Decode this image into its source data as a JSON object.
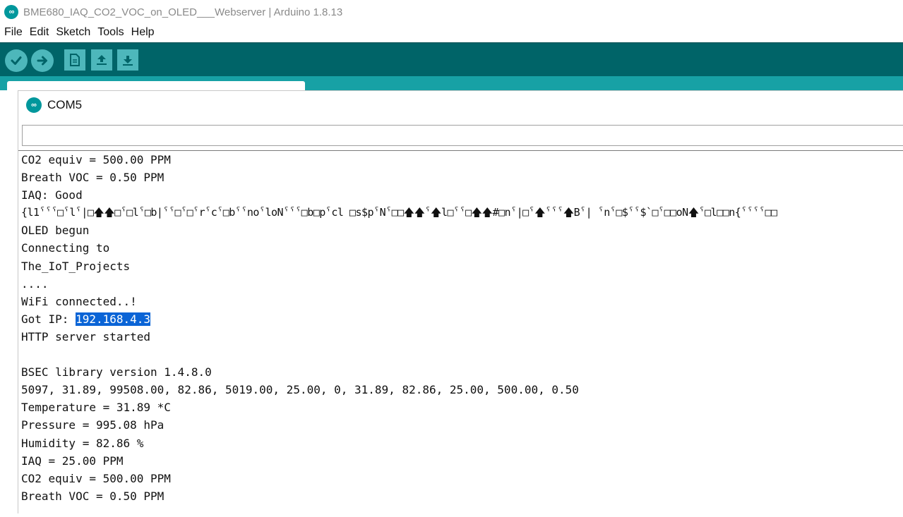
{
  "window": {
    "title": "BME680_IAQ_CO2_VOC_on_OLED___Webserver | Arduino 1.8.13",
    "icon": "arduino-logo-icon"
  },
  "menu": {
    "items": [
      "File",
      "Edit",
      "Sketch",
      "Tools",
      "Help"
    ]
  },
  "toolbar": {
    "buttons": [
      {
        "icon": "verify-icon"
      },
      {
        "icon": "upload-icon"
      },
      {
        "icon": "new-icon"
      },
      {
        "icon": "open-icon"
      },
      {
        "icon": "save-icon"
      }
    ]
  },
  "colors": {
    "toolbar_bg": "#006468",
    "tab_strip": "#17a1a5",
    "button_bg": "#4db7bb",
    "selection": "#0a64d6"
  },
  "serial_monitor": {
    "title": "COM5",
    "input_value": "",
    "lines": [
      "CO2 equiv = 500.00 PPM",
      "Breath VOC = 0.50 PPM",
      "IAQ: Good",
      "{l1ˁˁˁ□ˁlˁ|□🡅🡅□ˁ□lˁ□b|ˁˁ□ˁ□ˁrˁcˁ□bˁˁnoˁloNˁˁˁ□b□pˁcl □s$pˁNˁ□□🡅🡅ˁ🡅l□ˁˁ□🡅🡅#□nˁ|□ˁ🡅ˁˁˁ🡅Bˁ| ˁnˁ□$ˁˁ$`□ˁ□□oN🡅ˁ□l□□n{ˁˁˁˁ□□",
      "OLED begun",
      "Connecting to",
      "The_IoT_Projects",
      "....",
      "WiFi connected..!",
      "",
      "HTTP server started",
      "",
      "BSEC library version 1.4.8.0",
      "5097, 31.89, 99508.00, 82.86, 5019.00, 25.00, 0, 31.89, 82.86, 25.00, 500.00, 0.50",
      "Temperature = 31.89 *C",
      "Pressure = 995.08 hPa",
      "Humidity = 82.86 %",
      "IAQ = 25.00 PPM",
      "CO2 equiv = 500.00 PPM",
      "Breath VOC = 0.50 PPM"
    ],
    "ip_line_prefix": "Got IP: ",
    "ip_selected": "192.168.4.3"
  }
}
